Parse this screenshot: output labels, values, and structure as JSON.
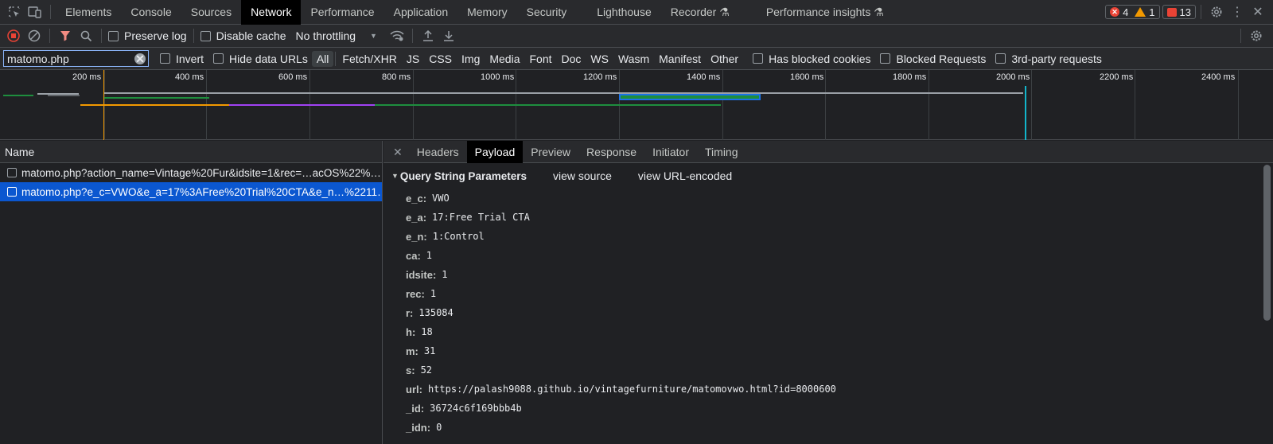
{
  "tabs": [
    "Elements",
    "Console",
    "Sources",
    "Network",
    "Performance",
    "Application",
    "Memory",
    "Security",
    "Lighthouse",
    "Recorder",
    "Performance insights"
  ],
  "active_tab": "Network",
  "status": {
    "errors": "4",
    "warnings": "1",
    "issues": "13"
  },
  "toolbar": {
    "preserve_log": "Preserve log",
    "disable_cache": "Disable cache",
    "throttling": "No throttling"
  },
  "filter": {
    "value": "matomo.php",
    "invert": "Invert",
    "hide_data_urls": "Hide data URLs",
    "types": [
      "All",
      "Fetch/XHR",
      "JS",
      "CSS",
      "Img",
      "Media",
      "Font",
      "Doc",
      "WS",
      "Wasm",
      "Manifest",
      "Other"
    ],
    "selected_type": "All",
    "has_blocked_cookies": "Has blocked cookies",
    "blocked_requests": "Blocked Requests",
    "third_party": "3rd-party requests"
  },
  "timeline": {
    "ticks": [
      "200 ms",
      "400 ms",
      "600 ms",
      "800 ms",
      "1000 ms",
      "1200 ms",
      "1400 ms",
      "1600 ms",
      "1800 ms",
      "2000 ms",
      "2200 ms",
      "2400 ms"
    ]
  },
  "requests": {
    "header": "Name",
    "rows": [
      "matomo.php?action_name=Vintage%20Fur&idsite=1&rec=…acOS%22%…",
      "matomo.php?e_c=VWO&e_a=17%3AFree%20Trial%20CTA&e_n…%2211…"
    ],
    "selected_index": 1
  },
  "detail": {
    "tabs": [
      "Headers",
      "Payload",
      "Preview",
      "Response",
      "Initiator",
      "Timing"
    ],
    "active_tab": "Payload",
    "section_title": "Query String Parameters",
    "view_source": "view source",
    "view_url_encoded": "view URL-encoded",
    "params": [
      {
        "key": "e_c:",
        "value": "VWO"
      },
      {
        "key": "e_a:",
        "value": "17:Free Trial CTA"
      },
      {
        "key": "e_n:",
        "value": "1:Control"
      },
      {
        "key": "ca:",
        "value": "1"
      },
      {
        "key": "idsite:",
        "value": "1"
      },
      {
        "key": "rec:",
        "value": "1"
      },
      {
        "key": "r:",
        "value": "135084"
      },
      {
        "key": "h:",
        "value": "18"
      },
      {
        "key": "m:",
        "value": "31"
      },
      {
        "key": "s:",
        "value": "52"
      },
      {
        "key": "url:",
        "value": "https://palash9088.github.io/vintagefurniture/matomovwo.html?id=8000600"
      },
      {
        "key": "_id:",
        "value": "36724c6f169bbb4b"
      },
      {
        "key": "_idn:",
        "value": "0"
      }
    ]
  }
}
